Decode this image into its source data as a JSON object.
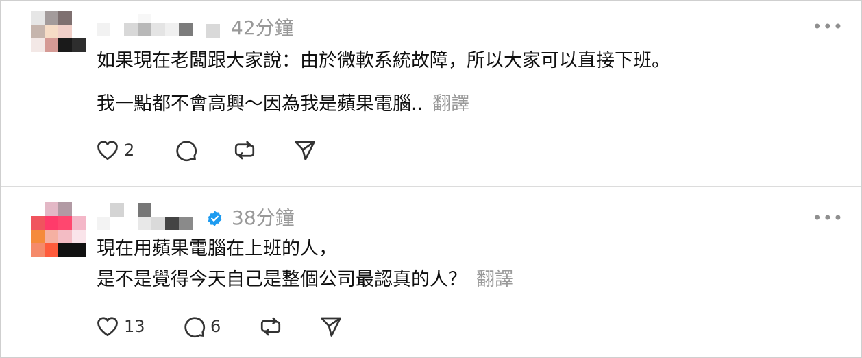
{
  "posts": [
    {
      "time": "42分鐘",
      "verified": false,
      "line1": "如果現在老闆跟大家說：由於微軟系統故障，所以大家可以直接下班。",
      "line2": "我一點都不會高興～因為我是蘋果電腦..",
      "translate_label": "翻譯",
      "likes": "2",
      "replies": ""
    },
    {
      "time": "38分鐘",
      "verified": true,
      "line1": "現在用蘋果電腦在上班的人，",
      "line2": "是不是覺得今天自己是整個公司最認真的人？",
      "translate_label": "翻譯",
      "likes": "13",
      "replies": "6"
    }
  ],
  "icons": {
    "like": "heart-icon",
    "reply": "comment-icon",
    "repost": "repost-icon",
    "share": "send-icon",
    "more": "more-icon",
    "verified": "verified-badge-icon"
  },
  "colors": {
    "verified": "#1d9bf0",
    "muted": "#999999",
    "text": "#101010"
  }
}
